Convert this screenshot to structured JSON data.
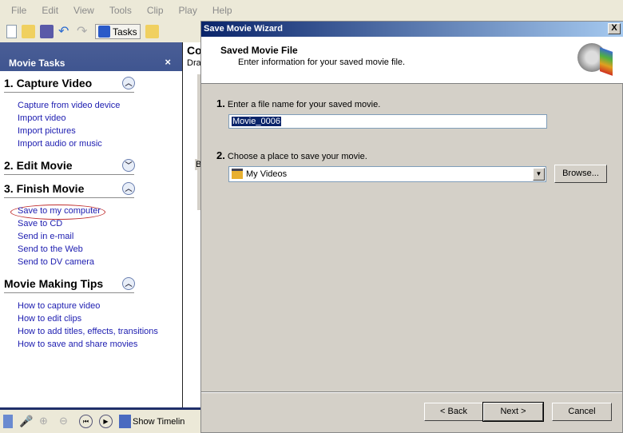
{
  "menu": [
    "File",
    "Edit",
    "View",
    "Tools",
    "Clip",
    "Play",
    "Help"
  ],
  "toolbar": {
    "tasks_label": "Tasks"
  },
  "left_pane": {
    "title": "Movie Tasks",
    "close": "×",
    "sections": [
      {
        "title": "1. Capture Video",
        "state": "expanded",
        "links": [
          "Capture from video device",
          "Import video",
          "Import pictures",
          "Import audio or music"
        ]
      },
      {
        "title": "2. Edit Movie",
        "state": "collapsed",
        "links": []
      },
      {
        "title": "3. Finish Movie",
        "state": "expanded",
        "links": [
          "Save to my computer",
          "Save to CD",
          "Send in e-mail",
          "Send to the Web",
          "Send to DV camera"
        ]
      },
      {
        "title": "Movie Making Tips",
        "state": "expanded",
        "links": [
          "How to capture video",
          "How to edit clips",
          "How to add titles, effects, transitions",
          "How to save and share movies"
        ]
      }
    ]
  },
  "mid": {
    "title": "Co",
    "sub": "Dra",
    "b": "B"
  },
  "bottom_bar": {
    "show_timeline": "Show Timelin"
  },
  "dialog": {
    "title": "Save Movie Wizard",
    "close": "X",
    "heading": "Saved Movie File",
    "subheading": "Enter information for your saved movie file.",
    "step1_num": "1.",
    "step1_label": "Enter a file name for your saved movie.",
    "filename": "Movie_0006",
    "step2_num": "2.",
    "step2_label": "Choose a place to save your movie.",
    "location": "My Videos",
    "browse": "Browse...",
    "back": "< Back",
    "next": "Next >",
    "cancel": "Cancel"
  },
  "colors": {
    "title_bar": "#0a246a",
    "link": "#1c1cb0",
    "panel_header": "#3f5590",
    "highlight_oval": "#c03030"
  }
}
